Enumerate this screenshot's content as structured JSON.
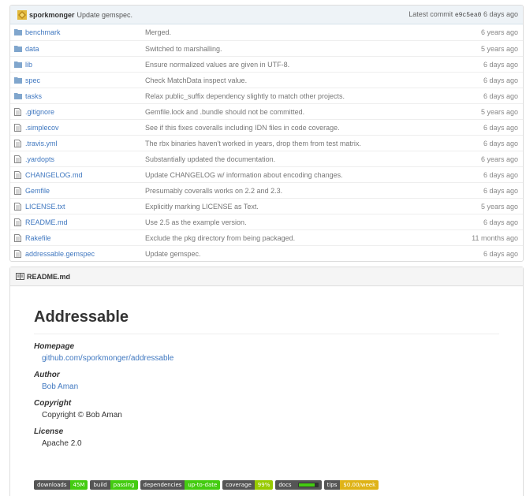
{
  "commit": {
    "author": "sporkmonger",
    "message": "Update gemspec.",
    "latest_label": "Latest commit",
    "sha": "e9c5ea0",
    "age": "6 days ago"
  },
  "files": [
    {
      "type": "folder",
      "name": "benchmark",
      "message": "Merged.",
      "age": "6 years ago"
    },
    {
      "type": "folder",
      "name": "data",
      "message": "Switched to marshalling.",
      "age": "5 years ago"
    },
    {
      "type": "folder",
      "name": "lib",
      "message": "Ensure normalized values are given in UTF-8.",
      "age": "6 days ago"
    },
    {
      "type": "folder",
      "name": "spec",
      "message": "Check MatchData inspect value.",
      "age": "6 days ago"
    },
    {
      "type": "folder",
      "name": "tasks",
      "message": "Relax public_suffix dependency slightly to match other projects.",
      "age": "6 days ago"
    },
    {
      "type": "file",
      "name": ".gitignore",
      "message": "Gemfile.lock and .bundle should not be committed.",
      "age": "5 years ago"
    },
    {
      "type": "file",
      "name": ".simplecov",
      "message": "See if this fixes coveralls including IDN files in code coverage.",
      "age": "6 days ago"
    },
    {
      "type": "file",
      "name": ".travis.yml",
      "message": "The rbx binaries haven't worked in years, drop them from test matrix.",
      "age": "6 days ago"
    },
    {
      "type": "file",
      "name": ".yardopts",
      "message": "Substantially updated the documentation.",
      "age": "6 years ago"
    },
    {
      "type": "file",
      "name": "CHANGELOG.md",
      "message": "Update CHANGELOG w/ information about encoding changes.",
      "age": "6 days ago"
    },
    {
      "type": "file",
      "name": "Gemfile",
      "message": "Presumably coveralls works on 2.2 and 2.3.",
      "age": "6 days ago"
    },
    {
      "type": "file",
      "name": "LICENSE.txt",
      "message": "Explicitly marking LICENSE as Text.",
      "age": "5 years ago"
    },
    {
      "type": "file",
      "name": "README.md",
      "message": "Use 2.5 as the example version.",
      "age": "6 days ago"
    },
    {
      "type": "file",
      "name": "Rakefile",
      "message": "Exclude the pkg directory from being packaged.",
      "age": "11 months ago"
    },
    {
      "type": "file",
      "name": "addressable.gemspec",
      "message": "Update gemspec.",
      "age": "6 days ago"
    }
  ],
  "readme": {
    "header": "README.md",
    "title": "Addressable",
    "fields": [
      {
        "term": "Homepage",
        "value": "github.com/sporkmonger/addressable",
        "link": true
      },
      {
        "term": "Author",
        "value": "Bob Aman",
        "link": true
      },
      {
        "term": "Copyright",
        "value": "Copyright © Bob Aman",
        "link": false
      },
      {
        "term": "License",
        "value": "Apache 2.0",
        "link": false
      }
    ]
  },
  "badges": [
    {
      "label": "downloads",
      "value": "45M",
      "color": "#4c1"
    },
    {
      "label": "build",
      "value": "passing",
      "color": "#4c1"
    },
    {
      "label": "dependencies",
      "value": "up-to-date",
      "color": "#4c1"
    },
    {
      "label": "coverage",
      "value": "99%",
      "color": "#97ca00"
    },
    {
      "label": "docs",
      "value": "",
      "color": "#555",
      "meter": 0.85
    },
    {
      "label": "tips",
      "value": "$0.00/week",
      "color": "#dfb317"
    }
  ],
  "colors": {
    "link": "#4078c0",
    "commit_bar": "#eef3f7"
  }
}
